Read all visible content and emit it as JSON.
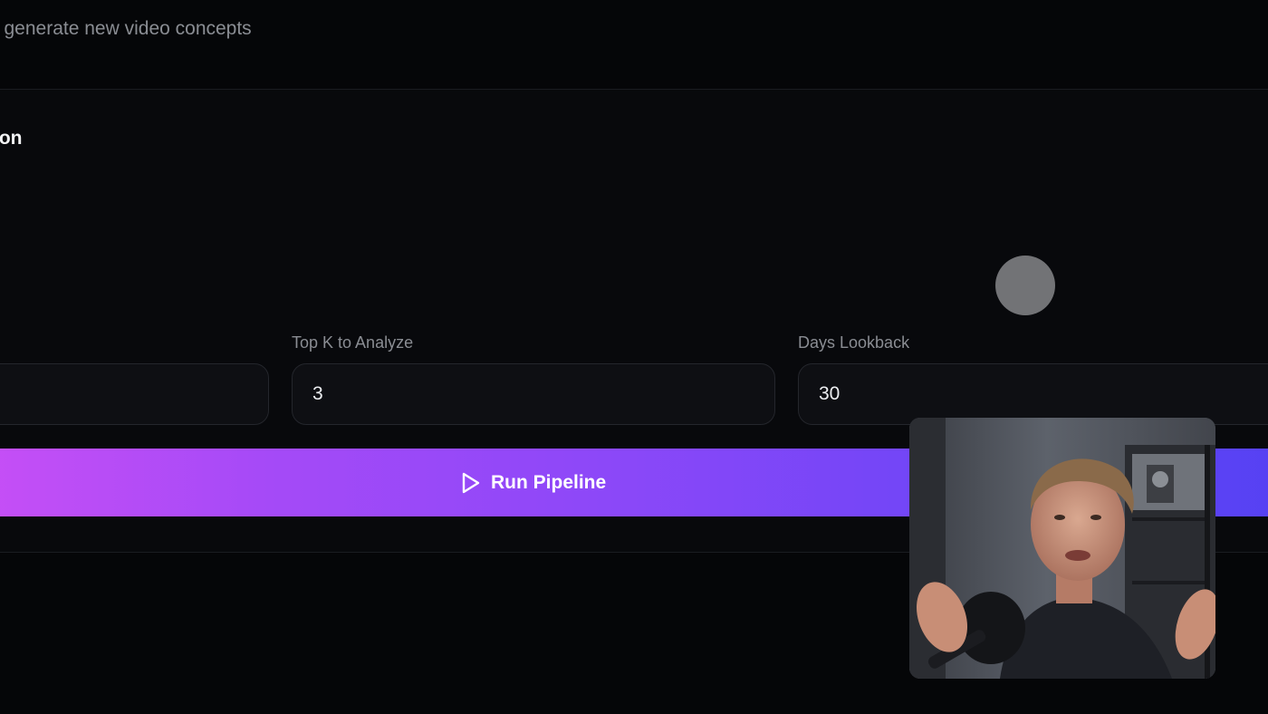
{
  "header": {
    "subtitle": "l generate new video concepts"
  },
  "card": {
    "title": "tion"
  },
  "fields": [
    {
      "label": "",
      "value": ""
    },
    {
      "label": "Top K to Analyze",
      "value": "3"
    },
    {
      "label": "Days Lookback",
      "value": "30"
    }
  ],
  "run_button": {
    "label": "Run Pipeline",
    "icon": "play-icon"
  },
  "colors": {
    "background": "#050608",
    "card": "#08090c",
    "input_bg": "#0e0f13",
    "input_border": "#24262c",
    "label": "#8a8d93",
    "button_gradient_start": "#c64ff6",
    "button_gradient_end": "#5541f3"
  },
  "overlays": {
    "cursor_indicator": "cursor-highlight",
    "webcam": "presenter-webcam-feed"
  }
}
